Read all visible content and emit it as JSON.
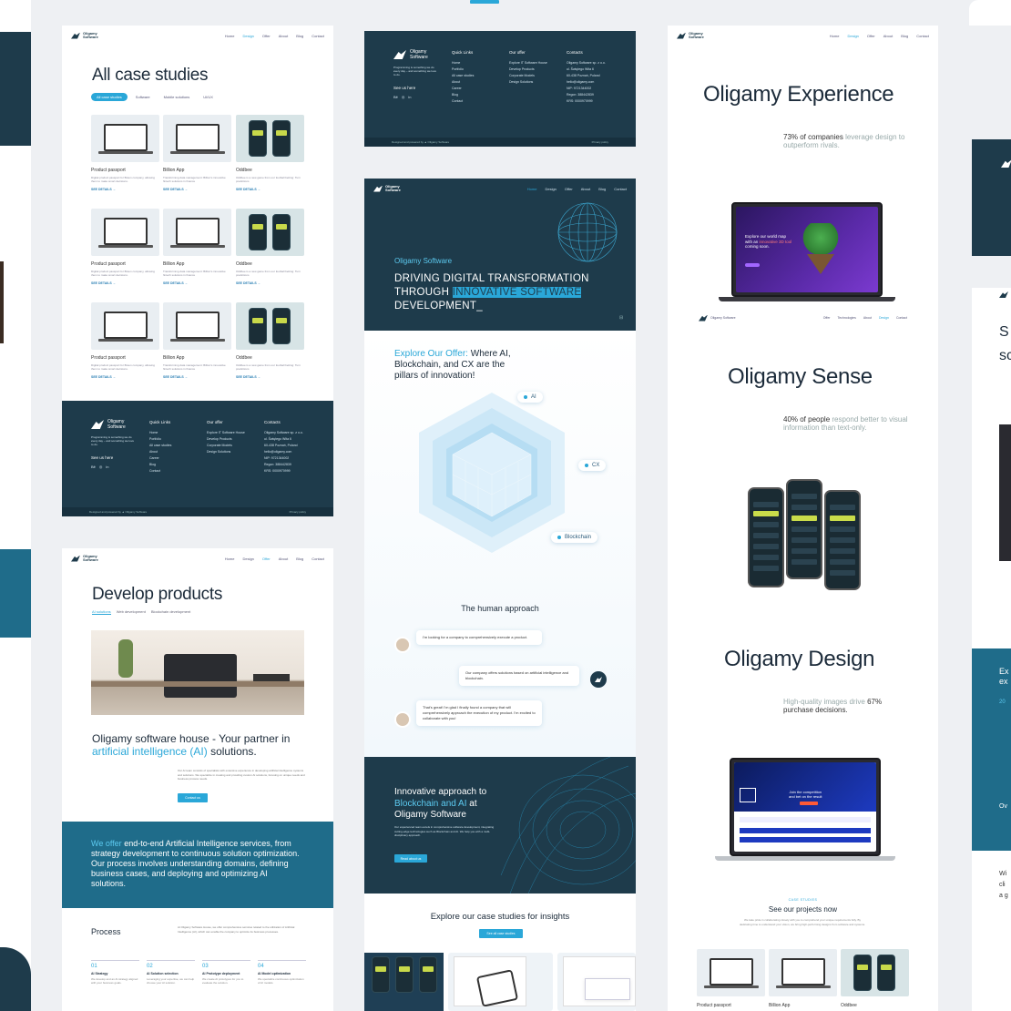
{
  "brand": {
    "name": "Oligamy Software"
  },
  "nav": {
    "home": "Home",
    "design": "Design",
    "offer": "Offer",
    "about": "About",
    "technologies": "Technologies",
    "blog": "Blog",
    "contact": "Contact"
  },
  "case_studies": {
    "title": "All case studies",
    "filters": [
      "All case studies",
      "Software",
      "Mobile solutions",
      "UI/UX"
    ],
    "cards": [
      {
        "title": "Product passport",
        "desc": "Digital product passport for Braun company, allowing them to make smart decisions.",
        "link": "SEE DETAILS"
      },
      {
        "title": "Billion App",
        "desc": "Transforming data management: Billion's innovative fintech solutions in finance",
        "link": "SEE DETAILS"
      },
      {
        "title": "Oddbee",
        "desc": "Oddbee is a new game from our football betting: Turn predictions",
        "link": "SEE DETAILS"
      }
    ]
  },
  "footer": {
    "tagline": "Programming is something we do every day – and something we love to do.",
    "see_us": "See us here",
    "quick_links_title": "Quick Links",
    "quick_links": [
      "Home",
      "Portfolio",
      "All case studies",
      "About",
      "Career",
      "Blog",
      "Contact"
    ],
    "offer_title": "Our offer",
    "offer": [
      "Explore IT Software House",
      "Develop Products",
      "Corporate Models",
      "Design Solutions"
    ],
    "contact_title": "Contacts",
    "contact": [
      "Oligamy Software sp. z o.o.",
      "ul. Świętego Wita 6",
      "60-438 Poznań, Poland",
      "hello@oligamy.com",
      "NIP: 9721344002",
      "Regon: 388442839",
      "KRS: 0000970999"
    ],
    "bar_left": "Designed and powered by",
    "bar_brand": "Oligamy Software",
    "bar_right": "Privacy policy"
  },
  "develop": {
    "title": "Develop products",
    "tabs": [
      "AI solutions",
      "Web development",
      "Blockchain development"
    ],
    "heading_a": "Oligamy software house - Your partner in",
    "heading_hl": "artificial intelligence (AI)",
    "heading_b": "solutions.",
    "body": "Our AI team consists of specialists with extensive experience in developing artificial intelligence systems and solutions. We specialize in creating and providing custom AI solutions, focusing on unique needs and business process needs.",
    "cta": "Contact us",
    "band_hl": "We offer",
    "band_text": "end-to-end Artificial Intelligence services, from strategy development to continuous solution optimization. Our process involves understanding domains, defining business cases, and deploying and optimizing AI solutions.",
    "process_title": "Process",
    "process_desc": "At Oligamy Software House, we offer comprehensive services related to the utilization of Artificial Intelligence (AI), which can enable the company to optimize its business processes.",
    "steps": [
      {
        "num": "01",
        "title": "AI Strategy",
        "desc": "We develop and an AI strategy aligned with your business goals."
      },
      {
        "num": "02",
        "title": "AI Solution selection",
        "desc": "Leveraging your expertise, we can help choose your AI solution."
      },
      {
        "num": "03",
        "title": "AI Prototype deployment",
        "desc": "We create AI prototypes for you to evaluate the solution."
      },
      {
        "num": "04",
        "title": "AI Model optimization",
        "desc": "We specialize continuous optimization of AI models."
      }
    ]
  },
  "landing": {
    "top_button": "",
    "hero_brand": "Oligamy Software",
    "hero_line1": "DRIVING DIGITAL TRANSFORMATION",
    "hero_line2a": "THROUGH",
    "hero_line2_hl": "INNOVATIVE SOFTWARE",
    "hero_line3": "DEVELOPMENT_",
    "explore_hl": "Explore Our Offer:",
    "explore_text": "Where AI, Blockchain, and CX are the pillars of innovation!",
    "tags": [
      "AI",
      "CX",
      "Blockchain"
    ],
    "human_title": "The human approach",
    "chat": [
      "I'm looking for a company to comprehensively execute a product.",
      "Our company offers solutions based on artificial intelligence and blockchain.",
      "That's great! I'm glad I finally found a company that will comprehensively approach the execution of my product. I'm excited to collaborate with you!"
    ],
    "innov_a": "Innovative approach to",
    "innov_hl": "Blockchain and AI",
    "innov_b": "at",
    "innov_c": "Oligamy Software",
    "innov_body": "Our experienced team excels in comprehensive software development, integrating cutting-edge technologies such as Blockchain and AI. We help you with a multi-disciplinary approach.",
    "innov_cta": "Read about us",
    "cases_title": "Explore our case studies for insights",
    "cases_cta": "See all case studies"
  },
  "showcase": {
    "experience_title": "Oligamy Experience",
    "experience_hl": "73% of companies",
    "experience_rest": "leverage design to outperform rivals.",
    "screen_text_a": "Explore our world map with an",
    "screen_text_hl": "innovative 3D tool",
    "screen_text_b": "coming soon.",
    "sense_title": "Oligamy Sense",
    "sense_hl": "40% of people",
    "sense_rest": "respond better to visual information than text-only.",
    "design_title": "Oligamy Design",
    "design_pre": "High-quality images drive",
    "design_hl": "67%",
    "design_rest": "purchase decisions.",
    "game_text_a": "Join the competition",
    "game_text_b": "and bet on the result",
    "projects_kicker": "CASE STUDIES",
    "projects_title": "See our projects now",
    "projects_desc": "We take pride in collaborating closely with you to comprehend your unique requirements fully. By dedicating time to understand your vision, we bring high-performing designs from software and systems.",
    "project_names": [
      "Product passport",
      "Billion App",
      "Oddbee"
    ]
  },
  "edge": {
    "right_title": "S",
    "right_title2": "sc",
    "right_kicker": "Ex",
    "right_line2": "ex",
    "right_year": "20",
    "right_ov": "Ov",
    "right_w": "Wi",
    "right_cl": "cli",
    "right_ag": "a g"
  },
  "colors": {
    "accent": "#2aa7d8",
    "navy": "#1e3b4b",
    "band": "#1f6c8a"
  }
}
